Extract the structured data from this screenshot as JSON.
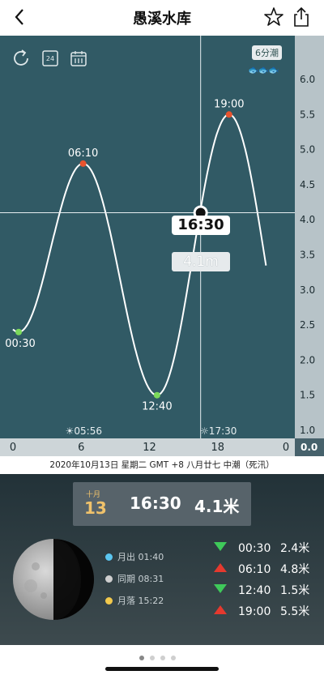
{
  "header": {
    "title": "愚溪水库",
    "back_icon": "back-chevron-icon",
    "favorite_icon": "star-icon",
    "share_icon": "share-icon"
  },
  "toolbar": {
    "icons": [
      "refresh-icon",
      "24h-icon",
      "calendar-icon"
    ],
    "badge": "6分潮"
  },
  "chart_data": {
    "type": "line",
    "x": [
      "00:30",
      "06:10",
      "12:40",
      "19:00"
    ],
    "extrema": [
      {
        "time": "00:30",
        "value": 2.4,
        "kind": "low"
      },
      {
        "time": "06:10",
        "value": 4.8,
        "kind": "high"
      },
      {
        "time": "12:40",
        "value": 1.5,
        "kind": "low"
      },
      {
        "time": "19:00",
        "value": 5.5,
        "kind": "high"
      }
    ],
    "xlim": [
      0,
      24
    ],
    "ylim": [
      1.0,
      6.0
    ],
    "x_ticks": [
      "0",
      "6",
      "12",
      "18",
      "0"
    ],
    "y_ticks": [
      "6.0",
      "5.5",
      "5.0",
      "4.5",
      "4.0",
      "3.5",
      "3.0",
      "2.5",
      "2.0",
      "1.5",
      "1.0"
    ],
    "y_tick_unlabeled": "0.0",
    "crosshair": {
      "time": "16:30",
      "value": "4.1m"
    },
    "sunrise": "05:56",
    "sunset": "17:30",
    "colors": {
      "background": "#315a65",
      "line": "#ffffff",
      "high": "#e8532e",
      "low": "#7bd95a",
      "axis_band": "#b7c3c8"
    }
  },
  "date_line": "2020年10月13日  星期二  GMT +8  八月廿七  中潮（死汛）",
  "current": {
    "month": "十月",
    "day": "13",
    "time": "16:30",
    "height": "4.1米"
  },
  "moon": {
    "rows": [
      {
        "label": "月出 01:40",
        "color": "#5bc6f0"
      },
      {
        "label": "同期 08:31",
        "color": "#cfcfcf"
      },
      {
        "label": "月落 15:22",
        "color": "#f2c94c"
      }
    ]
  },
  "tides": [
    {
      "dir": "down",
      "time": "00:30",
      "height": "2.4米"
    },
    {
      "dir": "up",
      "time": "06:10",
      "height": "4.8米"
    },
    {
      "dir": "down",
      "time": "12:40",
      "height": "1.5米"
    },
    {
      "dir": "up",
      "time": "19:00",
      "height": "5.5米"
    }
  ],
  "pager": {
    "count": 4,
    "active": 0
  }
}
